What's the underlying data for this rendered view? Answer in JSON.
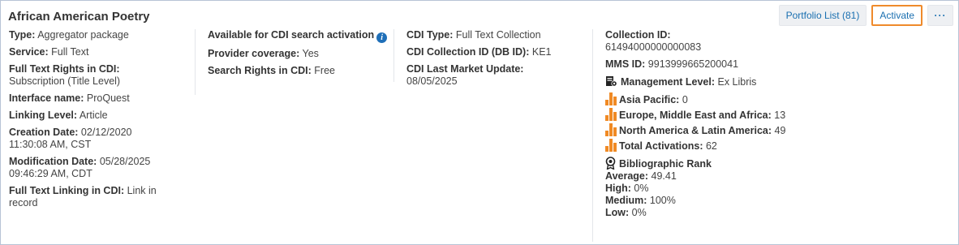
{
  "title": "African American Poetry",
  "actions": {
    "portfolio_list": "Portfolio List (81)",
    "activate": "Activate",
    "more": "···"
  },
  "col1": {
    "type_label": "Type:",
    "type_value": "Aggregator package",
    "service_label": "Service:",
    "service_value": "Full Text",
    "rights_label": "Full Text Rights in CDI:",
    "rights_value": "Subscription (Title Level)",
    "interface_label": "Interface name:",
    "interface_value": "ProQuest",
    "linking_label": "Linking Level:",
    "linking_value": "Article",
    "creation_label": "Creation Date:",
    "creation_value": "02/12/2020 11:30:08 AM, CST",
    "modification_label": "Modification Date:",
    "modification_value": "05/28/2025 09:46:29 AM, CDT",
    "ftl_label": "Full Text Linking in CDI:",
    "ftl_value": "Link in record"
  },
  "col2": {
    "available_label": "Available for CDI search activation",
    "provider_label": "Provider coverage:",
    "provider_value": "Yes",
    "search_rights_label": "Search Rights in CDI:",
    "search_rights_value": "Free"
  },
  "col3": {
    "cdi_type_label": "CDI Type:",
    "cdi_type_value": "Full Text Collection",
    "collection_label": "CDI Collection ID (DB ID):",
    "collection_value": "KE1",
    "market_label": "CDI Last Market Update:",
    "market_value": "08/05/2025"
  },
  "col4": {
    "collection_id_label": "Collection ID:",
    "collection_id_value": "61494000000000083",
    "mms_label": "MMS ID:",
    "mms_value": "9913999665200041",
    "mgmt_label": "Management Level:",
    "mgmt_value": "Ex Libris",
    "asia_label": "Asia Pacific:",
    "asia_value": "0",
    "emea_label": "Europe, Middle East and Africa:",
    "emea_value": "13",
    "nala_label": "North America & Latin America:",
    "nala_value": "49",
    "total_label": "Total Activations:",
    "total_value": "62",
    "rank_label": "Bibliographic Rank",
    "average_label": "Average:",
    "average_value": "49.41",
    "high_label": "High:",
    "high_value": "0%",
    "medium_label": "Medium:",
    "medium_value": "100%",
    "low_label": "Low:",
    "low_value": "0%"
  },
  "colors": {
    "accent": "#1a6fb0",
    "highlight": "#ef8a2b",
    "bars": "#f08a24",
    "info": "#1f6fb8"
  }
}
